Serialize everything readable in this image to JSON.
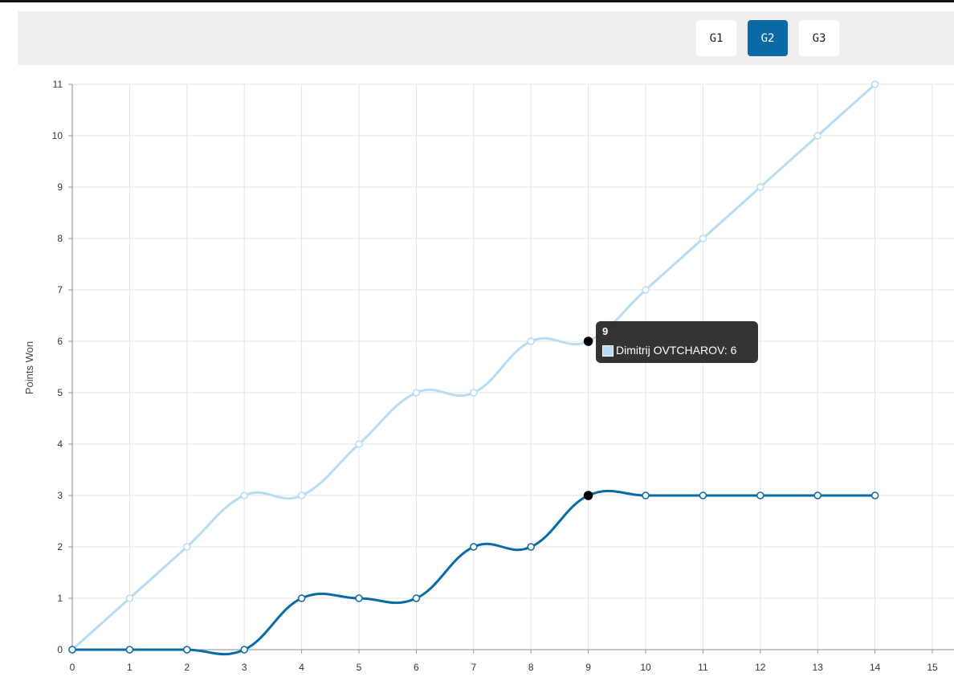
{
  "game_selector": {
    "buttons": [
      {
        "label": "G1",
        "active": false
      },
      {
        "label": "G2",
        "active": true
      },
      {
        "label": "G3",
        "active": false
      }
    ]
  },
  "tooltip": {
    "title": "9",
    "label": "Dimitrij OVTCHAROV: 6"
  },
  "colors": {
    "series_light": "#b7dcf3",
    "series_dark": "#0a6aa6",
    "active_button": "#0a6aa6"
  },
  "chart_data": {
    "type": "line",
    "ylabel": "Points Won",
    "xlabel": "",
    "xlim": [
      0,
      15
    ],
    "ylim": [
      0,
      11
    ],
    "x_ticks": [
      "0",
      "1",
      "2",
      "3",
      "4",
      "5",
      "6",
      "7",
      "8",
      "9",
      "10",
      "11",
      "12",
      "13",
      "14",
      "15"
    ],
    "y_ticks": [
      "0",
      "1",
      "2",
      "3",
      "4",
      "5",
      "6",
      "7",
      "8",
      "9",
      "10",
      "11"
    ],
    "grid": true,
    "x": [
      0,
      1,
      2,
      3,
      4,
      5,
      6,
      7,
      8,
      9,
      10,
      11,
      12,
      13,
      14
    ],
    "series": [
      {
        "name": "Dimitrij OVTCHAROV",
        "color": "#b7dcf3",
        "values": [
          0,
          1,
          2,
          3,
          3,
          4,
          5,
          5,
          6,
          6,
          7,
          8,
          9,
          10,
          11
        ]
      },
      {
        "color": "#0a6aa6",
        "values": [
          0,
          0,
          0,
          0,
          1,
          1,
          1,
          2,
          2,
          3,
          3,
          3,
          3,
          3,
          3
        ]
      }
    ],
    "highlight_x": 9
  }
}
